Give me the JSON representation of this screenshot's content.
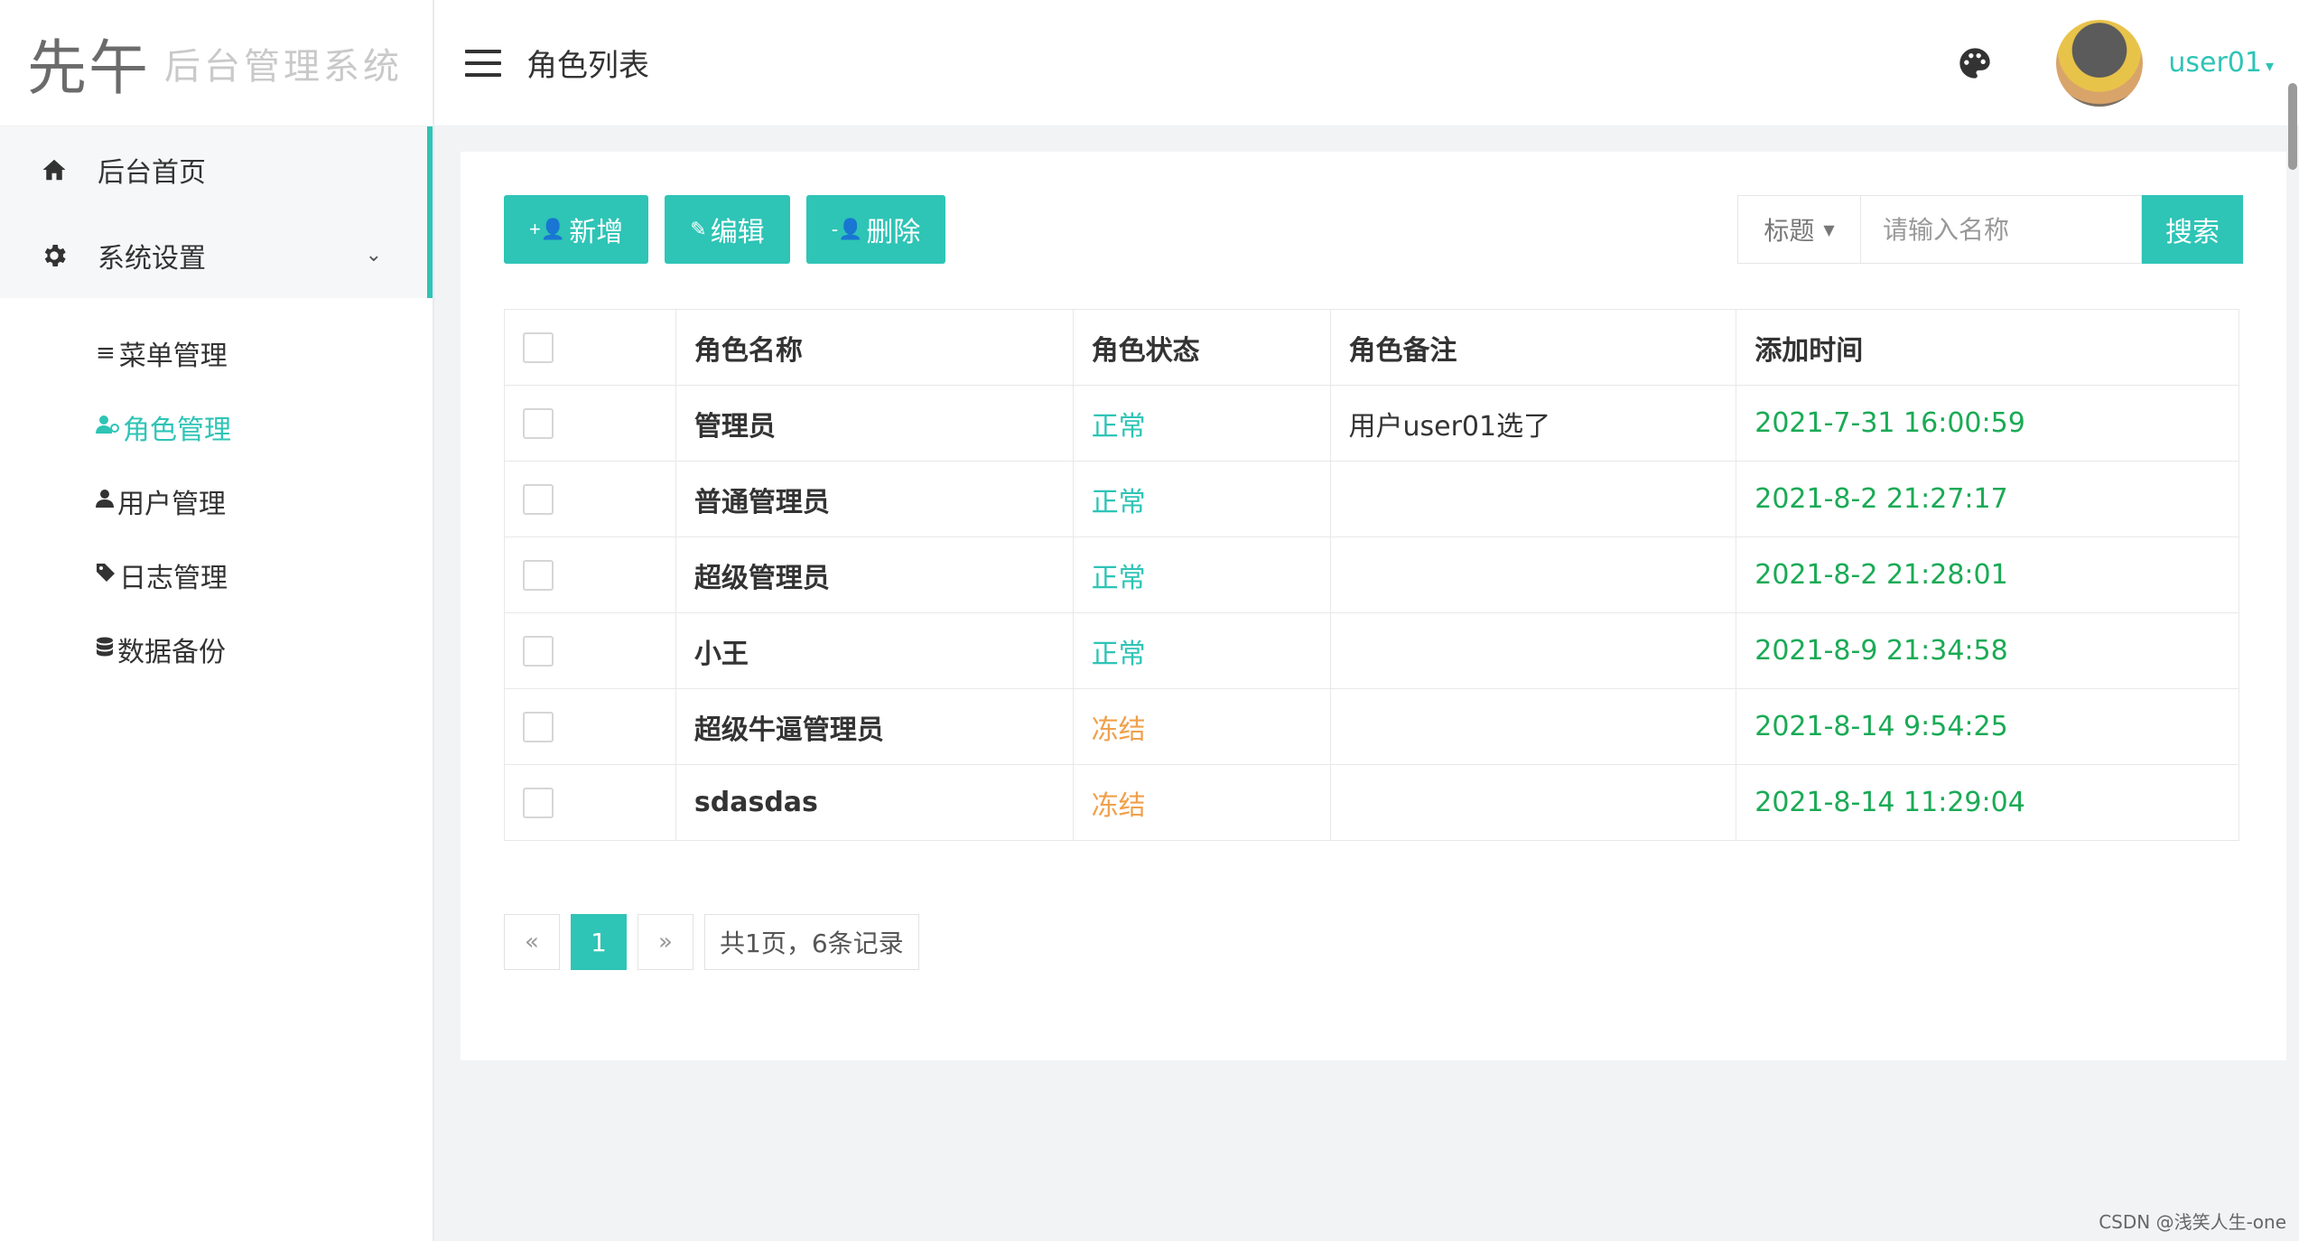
{
  "app": {
    "logo_mark": "先午",
    "logo_text": "后台管理系统"
  },
  "sidebar": {
    "items": [
      {
        "label": "后台首页",
        "icon": "home-icon"
      },
      {
        "label": "系统设置",
        "icon": "gear-icon"
      }
    ],
    "sub_items": [
      {
        "label": "菜单管理",
        "icon": "list-icon",
        "glyph": "≡"
      },
      {
        "label": "角色管理",
        "icon": "users-icon",
        "glyph": "👥"
      },
      {
        "label": "用户管理",
        "icon": "user-icon",
        "glyph": "👤"
      },
      {
        "label": "日志管理",
        "icon": "tag-icon",
        "glyph": "🏷"
      },
      {
        "label": "数据备份",
        "icon": "database-icon",
        "glyph": "🛢"
      }
    ],
    "active_sub": "角色管理"
  },
  "header": {
    "title": "角色列表",
    "username": "user01"
  },
  "toolbar": {
    "add_label": "新增",
    "edit_label": "编辑",
    "delete_label": "删除",
    "filter_label": "标题",
    "search_placeholder": "请输入名称",
    "search_value": "",
    "search_label": "搜索"
  },
  "table": {
    "headers": [
      "角色名称",
      "角色状态",
      "角色备注",
      "添加时间"
    ],
    "rows": [
      {
        "name": "管理员",
        "status": "正常",
        "remark": "用户user01选了",
        "time": "2021-7-31 16:00:59"
      },
      {
        "name": "普通管理员",
        "status": "正常",
        "remark": "",
        "time": "2021-8-2 21:27:17"
      },
      {
        "name": "超级管理员",
        "status": "正常",
        "remark": "",
        "time": "2021-8-2 21:28:01"
      },
      {
        "name": "小王",
        "status": "正常",
        "remark": "",
        "time": "2021-8-9 21:34:58"
      },
      {
        "name": "超级牛逼管理员",
        "status": "冻结",
        "remark": "",
        "time": "2021-8-14 9:54:25"
      },
      {
        "name": "sdasdas",
        "status": "冻结",
        "remark": "",
        "time": "2021-8-14 11:29:04"
      }
    ]
  },
  "pagination": {
    "prev": "«",
    "current": "1",
    "next": "»",
    "info": "共1页，6条记录"
  },
  "colors": {
    "accent": "#2ec4b6",
    "status_ok": "#2ec4b6",
    "status_frozen": "#f0a04b",
    "time": "#1aaa55"
  },
  "watermark": "CSDN @浅笑人生-one"
}
